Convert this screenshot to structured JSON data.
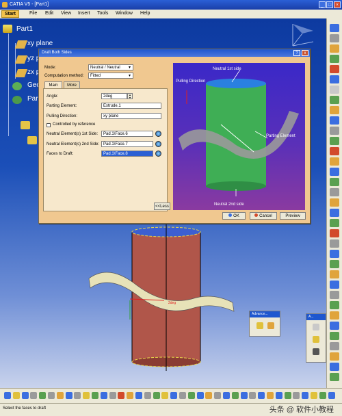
{
  "window": {
    "title": "CATIA V5 - [Part1]"
  },
  "menu": {
    "items": [
      "Start",
      "File",
      "Edit",
      "View",
      "Insert",
      "Tools",
      "Window",
      "Help"
    ]
  },
  "tree": {
    "root": "Part1",
    "items": [
      "xy plane",
      "yz plane",
      "zx plane",
      "Geo",
      "Par"
    ]
  },
  "dialog": {
    "title": "Draft Both Sides",
    "mode_label": "Mode:",
    "mode_value": "Neutral / Neutral",
    "computation_label": "Computation method:",
    "computation_value": "Fitted",
    "tabs": [
      "Main",
      "More"
    ],
    "angle_label": "Angle:",
    "angle_value": "2deg",
    "parting_label": "Parting Element:",
    "parting_value": "Extrude.1",
    "pulling_label": "Pulling Direction:",
    "pulling_value": "xy plane",
    "controlled_label": "Controlled by reference",
    "neutral1_label": "Neutral Element(s) 1st Side:",
    "neutral1_value": "Pad.1\\Face.6",
    "neutral2_label": "Neutral Element(s) 2nd Side:",
    "neutral2_value": "Pad.1\\Face.7",
    "faces_label": "Faces to Draft:",
    "faces_value": "Pad.1\\Face.8",
    "less_label": "<<Less",
    "ok_label": "OK",
    "cancel_label": "Cancel",
    "preview_label": "Preview",
    "help_btn": "?",
    "close_btn": "x"
  },
  "preview_image": {
    "neutral_1st": "Neutral 1st side",
    "pulling_direction": "Pulling Direction",
    "parting_element": "Parting Element",
    "neutral_2nd": "Neutral 2nd side"
  },
  "model": {
    "angle_tag": "2deg"
  },
  "advanced": {
    "title": "Advance..."
  },
  "a_toolbar": {
    "title": "A..."
  },
  "status": {
    "text": "Select the faces to draft",
    "watermark": "头条 @ 软件小教程"
  },
  "colors": {
    "selection": "#2a5fd4",
    "accent": "#f0c890",
    "cylinder": "#b0564a"
  }
}
